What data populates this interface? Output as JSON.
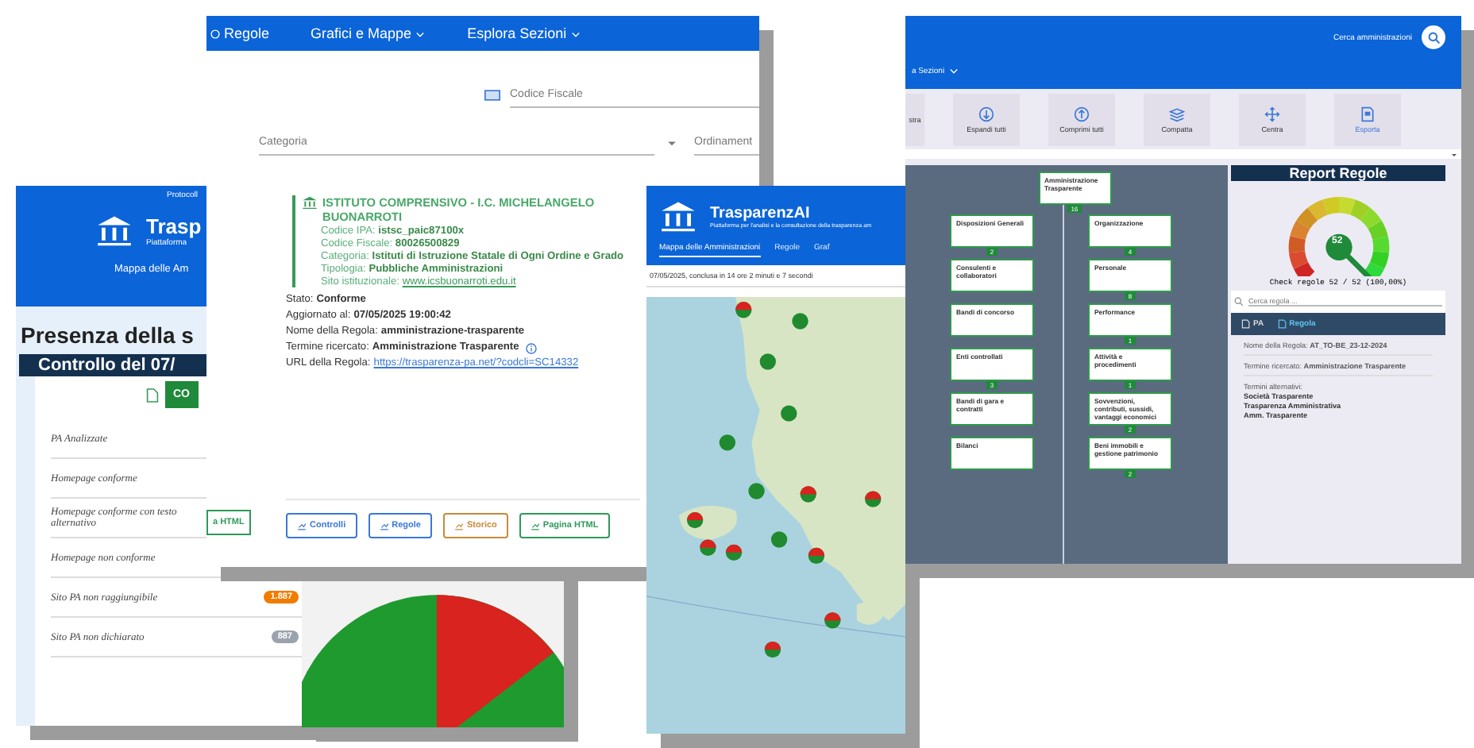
{
  "search_panel": {
    "nav": [
      {
        "label": "Regole",
        "kind": "link"
      },
      {
        "label": "Grafici e Mappe",
        "kind": "menu"
      },
      {
        "label": "Esplora Sezioni",
        "kind": "menu"
      }
    ],
    "fields": [
      {
        "placeholder": "Codice Fiscale",
        "kind": "text"
      },
      {
        "placeholder": "Categoria",
        "kind": "select"
      },
      {
        "placeholder": "Ordinament",
        "kind": "text"
      }
    ]
  },
  "overview_panel": {
    "top_link": "Protocoll",
    "title": "Trasp",
    "subtitle": "Piattaforma",
    "map_link": "Mappa delle Am",
    "heading": "Presenza della s",
    "section": "Controllo del 07/",
    "action_button": "CO",
    "side_button": "a HTML",
    "rows": [
      {
        "label": "PA Analizzate"
      },
      {
        "label": "Homepage conforme"
      },
      {
        "label": "Homepage conforme con testo alternativo"
      },
      {
        "label": "Homepage non conforme"
      },
      {
        "label": "Sito PA non raggiungibile",
        "badge": "1.887",
        "color": "#f07c00"
      },
      {
        "label": "Sito PA non dichiarato",
        "badge": "887",
        "color": "#9aa3ad"
      }
    ]
  },
  "detail_card": {
    "title": "ISTITUTO COMPRENSIVO - I.C. MICHELANGELO BUONARROTI",
    "fields": [
      {
        "label": "Codice IPA:",
        "value": "istsc_paic87100x",
        "kind": "text"
      },
      {
        "label": "Codice Fiscale:",
        "value": "80026500829",
        "kind": "text"
      },
      {
        "label": "Categoria:",
        "value": "Istituti di Istruzione Statale di Ogni Ordine e Grado",
        "kind": "text"
      },
      {
        "label": "Tipologia:",
        "value": "Pubbliche Amministrazioni",
        "kind": "text"
      },
      {
        "label": "Sito istituzionale:",
        "value": "www.icsbuonarroti.edu.it",
        "kind": "link"
      }
    ],
    "status": [
      {
        "label": "Stato:",
        "value": "Conforme",
        "kind": "text",
        "info": false
      },
      {
        "label": "Aggiornato al:",
        "value": "07/05/2025 19:00:42",
        "kind": "text",
        "info": false
      },
      {
        "label": "Nome della Regola:",
        "value": "amministrazione-trasparente",
        "kind": "text",
        "info": false
      },
      {
        "label": "Termine ricercato:",
        "value": "Amministrazione Trasparente",
        "kind": "text",
        "info": true
      },
      {
        "label": "URL della Regola:",
        "value": "https://trasparenza-pa.net/?codcli=SC14332",
        "kind": "link",
        "info": false
      }
    ],
    "buttons": [
      {
        "label": "Controlli",
        "color": "#3a78d8"
      },
      {
        "label": "Regole",
        "color": "#3a78d8"
      },
      {
        "label": "Storico",
        "color": "#c98a3a"
      },
      {
        "label": "Pagina HTML",
        "color": "#2e9a5a"
      }
    ]
  },
  "map_panel": {
    "title": "TrasparenzAI",
    "subtitle": "Piattaforma per l'analisi e la consultazione della trasparenza am",
    "tabs": [
      {
        "label": "Mappa delle Amministrazioni",
        "selected": true
      },
      {
        "label": "Regole",
        "selected": false
      },
      {
        "label": "Graf",
        "selected": false
      }
    ],
    "note": "07/05/2025, conclusa in 14 ore 2 minuti e 7 secondi"
  },
  "tree_panel": {
    "search_label": "Cerca amministrazioni",
    "nav": "a Sezioni",
    "toolbar": [
      "stra",
      "Espandi tutti",
      "Comprimi tutti",
      "Compatta",
      "Centra",
      "Esporta"
    ],
    "root": {
      "label": "Amministrazione Trasparente",
      "count": "16"
    },
    "nodes": [
      {
        "label": "Disposizioni Generali",
        "count": "2"
      },
      {
        "label": "Organizzazione",
        "count": "4"
      },
      {
        "label": "Consulenti e collaboratori"
      },
      {
        "label": "Personale",
        "count": "8"
      },
      {
        "label": "Bandi di concorso"
      },
      {
        "label": "Performance",
        "count": "1"
      },
      {
        "label": "Enti controllati",
        "count": "3"
      },
      {
        "label": "Attività e procedimenti",
        "count": "1"
      },
      {
        "label": "Bandi di gara e contratti"
      },
      {
        "label": "Sovvenzioni, contributi, sussidi, vantaggi economici",
        "count": "2"
      },
      {
        "label": "Bilanci"
      },
      {
        "label": "Beni immobili e gestione patrimonio",
        "count": "2"
      }
    ]
  },
  "report": {
    "title": "Report Regole",
    "gauge_value": "52",
    "level": 1,
    "check": "Check regole 52 / 52 (100,00%)",
    "search": {
      "placeholder": "Cerca regola ..."
    },
    "tabs": [
      {
        "label": "PA",
        "selected": false
      },
      {
        "label": "Regola",
        "selected": true
      }
    ],
    "rule_name": "Nome della Regola: **AT_TO-BE_23-12-2024**",
    "term": "Termine ricercato: **Amministrazione Trasparente**",
    "alt_label": "Termini alternativi:",
    "alternatives": [
      "Società Trasparente",
      "Trasparenza Amministrativa",
      "Amm. Trasparente"
    ]
  }
}
